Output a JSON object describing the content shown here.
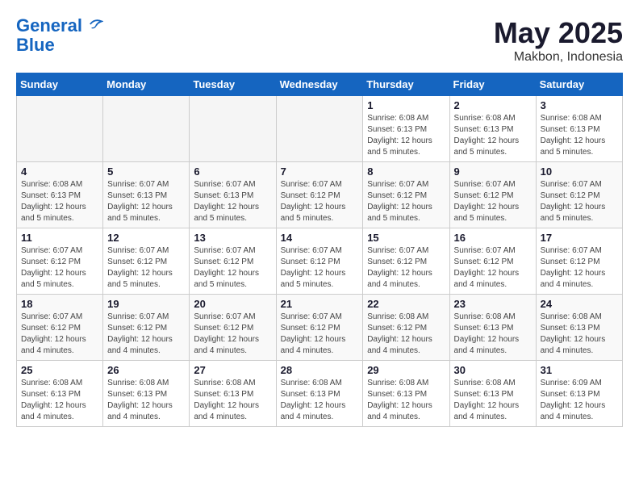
{
  "logo": {
    "line1": "General",
    "line2": "Blue"
  },
  "title": "May 2025",
  "subtitle": "Makbon, Indonesia",
  "days_of_week": [
    "Sunday",
    "Monday",
    "Tuesday",
    "Wednesday",
    "Thursday",
    "Friday",
    "Saturday"
  ],
  "weeks": [
    [
      {
        "day": "",
        "info": ""
      },
      {
        "day": "",
        "info": ""
      },
      {
        "day": "",
        "info": ""
      },
      {
        "day": "",
        "info": ""
      },
      {
        "day": "1",
        "info": "Sunrise: 6:08 AM\nSunset: 6:13 PM\nDaylight: 12 hours\nand 5 minutes."
      },
      {
        "day": "2",
        "info": "Sunrise: 6:08 AM\nSunset: 6:13 PM\nDaylight: 12 hours\nand 5 minutes."
      },
      {
        "day": "3",
        "info": "Sunrise: 6:08 AM\nSunset: 6:13 PM\nDaylight: 12 hours\nand 5 minutes."
      }
    ],
    [
      {
        "day": "4",
        "info": "Sunrise: 6:08 AM\nSunset: 6:13 PM\nDaylight: 12 hours\nand 5 minutes."
      },
      {
        "day": "5",
        "info": "Sunrise: 6:07 AM\nSunset: 6:13 PM\nDaylight: 12 hours\nand 5 minutes."
      },
      {
        "day": "6",
        "info": "Sunrise: 6:07 AM\nSunset: 6:13 PM\nDaylight: 12 hours\nand 5 minutes."
      },
      {
        "day": "7",
        "info": "Sunrise: 6:07 AM\nSunset: 6:12 PM\nDaylight: 12 hours\nand 5 minutes."
      },
      {
        "day": "8",
        "info": "Sunrise: 6:07 AM\nSunset: 6:12 PM\nDaylight: 12 hours\nand 5 minutes."
      },
      {
        "day": "9",
        "info": "Sunrise: 6:07 AM\nSunset: 6:12 PM\nDaylight: 12 hours\nand 5 minutes."
      },
      {
        "day": "10",
        "info": "Sunrise: 6:07 AM\nSunset: 6:12 PM\nDaylight: 12 hours\nand 5 minutes."
      }
    ],
    [
      {
        "day": "11",
        "info": "Sunrise: 6:07 AM\nSunset: 6:12 PM\nDaylight: 12 hours\nand 5 minutes."
      },
      {
        "day": "12",
        "info": "Sunrise: 6:07 AM\nSunset: 6:12 PM\nDaylight: 12 hours\nand 5 minutes."
      },
      {
        "day": "13",
        "info": "Sunrise: 6:07 AM\nSunset: 6:12 PM\nDaylight: 12 hours\nand 5 minutes."
      },
      {
        "day": "14",
        "info": "Sunrise: 6:07 AM\nSunset: 6:12 PM\nDaylight: 12 hours\nand 5 minutes."
      },
      {
        "day": "15",
        "info": "Sunrise: 6:07 AM\nSunset: 6:12 PM\nDaylight: 12 hours\nand 4 minutes."
      },
      {
        "day": "16",
        "info": "Sunrise: 6:07 AM\nSunset: 6:12 PM\nDaylight: 12 hours\nand 4 minutes."
      },
      {
        "day": "17",
        "info": "Sunrise: 6:07 AM\nSunset: 6:12 PM\nDaylight: 12 hours\nand 4 minutes."
      }
    ],
    [
      {
        "day": "18",
        "info": "Sunrise: 6:07 AM\nSunset: 6:12 PM\nDaylight: 12 hours\nand 4 minutes."
      },
      {
        "day": "19",
        "info": "Sunrise: 6:07 AM\nSunset: 6:12 PM\nDaylight: 12 hours\nand 4 minutes."
      },
      {
        "day": "20",
        "info": "Sunrise: 6:07 AM\nSunset: 6:12 PM\nDaylight: 12 hours\nand 4 minutes."
      },
      {
        "day": "21",
        "info": "Sunrise: 6:07 AM\nSunset: 6:12 PM\nDaylight: 12 hours\nand 4 minutes."
      },
      {
        "day": "22",
        "info": "Sunrise: 6:08 AM\nSunset: 6:12 PM\nDaylight: 12 hours\nand 4 minutes."
      },
      {
        "day": "23",
        "info": "Sunrise: 6:08 AM\nSunset: 6:13 PM\nDaylight: 12 hours\nand 4 minutes."
      },
      {
        "day": "24",
        "info": "Sunrise: 6:08 AM\nSunset: 6:13 PM\nDaylight: 12 hours\nand 4 minutes."
      }
    ],
    [
      {
        "day": "25",
        "info": "Sunrise: 6:08 AM\nSunset: 6:13 PM\nDaylight: 12 hours\nand 4 minutes."
      },
      {
        "day": "26",
        "info": "Sunrise: 6:08 AM\nSunset: 6:13 PM\nDaylight: 12 hours\nand 4 minutes."
      },
      {
        "day": "27",
        "info": "Sunrise: 6:08 AM\nSunset: 6:13 PM\nDaylight: 12 hours\nand 4 minutes."
      },
      {
        "day": "28",
        "info": "Sunrise: 6:08 AM\nSunset: 6:13 PM\nDaylight: 12 hours\nand 4 minutes."
      },
      {
        "day": "29",
        "info": "Sunrise: 6:08 AM\nSunset: 6:13 PM\nDaylight: 12 hours\nand 4 minutes."
      },
      {
        "day": "30",
        "info": "Sunrise: 6:08 AM\nSunset: 6:13 PM\nDaylight: 12 hours\nand 4 minutes."
      },
      {
        "day": "31",
        "info": "Sunrise: 6:09 AM\nSunset: 6:13 PM\nDaylight: 12 hours\nand 4 minutes."
      }
    ]
  ]
}
